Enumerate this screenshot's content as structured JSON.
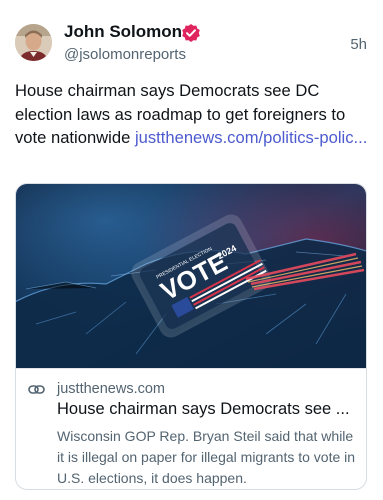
{
  "author": {
    "name": "John Solomon",
    "handle": "@jsolomonreports",
    "time": "5h"
  },
  "post": {
    "text": "House chairman says Democrats see DC election laws as roadmap to get foreigners to vote nationwide ",
    "link_display": "justthenews.com/politics-polic..."
  },
  "card": {
    "image_text": {
      "main": "VOTE",
      "year": "2024",
      "banner": "PRESIDENTIAL ELECTION"
    },
    "domain": "justthenews.com",
    "title": "House chairman says Democrats see ...",
    "description": "Wisconsin GOP Rep. Bryan Steil said that while it is illegal on paper for illegal migrants to vote in U.S. elections, it does happen."
  },
  "colors": {
    "verified_badge": "#e0245e",
    "link": "#4d5bce",
    "secondary_text": "#536471"
  },
  "icons": {
    "verified": "verified-badge-icon",
    "link": "link-icon"
  }
}
